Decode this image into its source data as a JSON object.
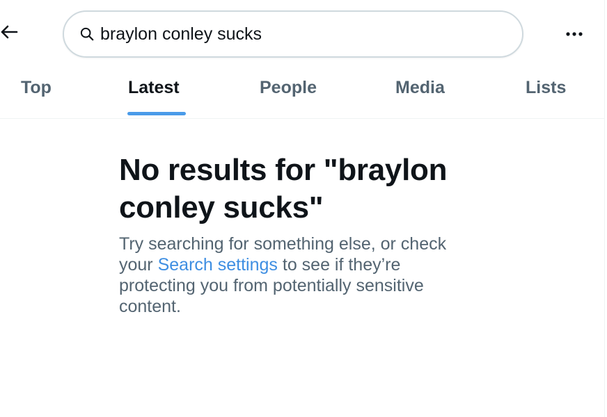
{
  "header": {
    "back_icon": "arrow-left-icon",
    "search": {
      "icon": "search-icon",
      "value": "braylon conley sucks",
      "placeholder": "Search"
    },
    "more_icon": "more-horizontal-icon"
  },
  "tabs": [
    {
      "label": "Top",
      "active": false
    },
    {
      "label": "Latest",
      "active": true
    },
    {
      "label": "People",
      "active": false
    },
    {
      "label": "Media",
      "active": false
    },
    {
      "label": "Lists",
      "active": false
    }
  ],
  "empty_state": {
    "title_prefix": "No results for",
    "query_quoted": "\"braylon conley sucks\"",
    "desc_before_link": "Try searching for something else, or check your ",
    "link_text": "Search settings",
    "desc_after_link": " to see if they’re protecting you from potentially sensitive content."
  },
  "colors": {
    "accent": "#4a9be9",
    "link": "#3e8ee2",
    "text_primary": "#0f1419",
    "text_secondary": "#536471",
    "border": "#cfd9de"
  }
}
